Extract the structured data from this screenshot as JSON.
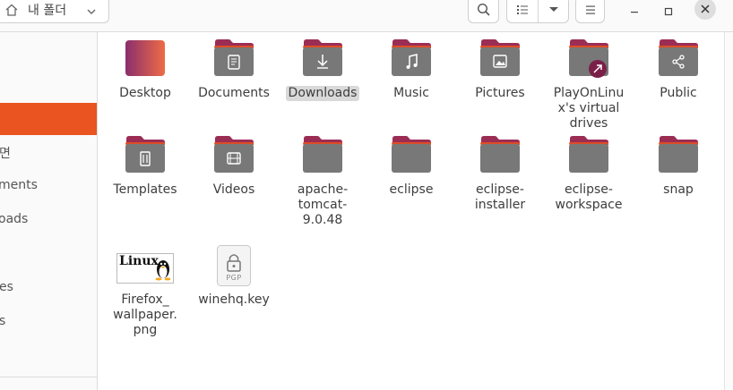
{
  "header": {
    "path_label": "내 폴더",
    "icons": [
      "home-icon",
      "chevron-down-icon",
      "search-icon",
      "list-view-icon",
      "menu-icon",
      "minimize-icon",
      "maximize-icon",
      "close-icon"
    ]
  },
  "sidebar": {
    "items": [
      {
        "label": "면"
      },
      {
        "label": "ments"
      },
      {
        "label": "oads"
      },
      {
        "label": "es"
      },
      {
        "label": "s"
      }
    ]
  },
  "colors": {
    "accent": "#e95420",
    "folder_tab": "#9b2d55",
    "folder_body": "#787878",
    "folder_top_accent": "#e95420"
  },
  "files": [
    {
      "label": "Desktop",
      "icon": "desktop-folder-icon"
    },
    {
      "label": "Documents",
      "icon": "documents-folder-icon"
    },
    {
      "label": "Downloads",
      "icon": "downloads-folder-icon",
      "selected": true
    },
    {
      "label": "Music",
      "icon": "music-folder-icon"
    },
    {
      "label": "Pictures",
      "icon": "pictures-folder-icon"
    },
    {
      "label": "PlayOnLinux's virtual drives",
      "lines": [
        "PlayOnLinu",
        "x's virtual",
        "drives"
      ],
      "icon": "link-folder-icon"
    },
    {
      "label": "Public",
      "icon": "share-folder-icon"
    },
    {
      "label": "Templates",
      "icon": "templates-folder-icon"
    },
    {
      "label": "Videos",
      "icon": "video-folder-icon"
    },
    {
      "label": "apache-tomcat-9.0.48",
      "lines": [
        "apache-",
        "tomcat-",
        "9.0.48"
      ],
      "icon": "folder-icon"
    },
    {
      "label": "eclipse",
      "icon": "folder-icon"
    },
    {
      "label": "eclipse-installer",
      "lines": [
        "eclipse-",
        "installer"
      ],
      "icon": "folder-icon"
    },
    {
      "label": "eclipse-workspace",
      "lines": [
        "eclipse-",
        "workspace"
      ],
      "icon": "folder-icon"
    },
    {
      "label": "snap",
      "icon": "folder-icon"
    },
    {
      "label": "Firefox_wallpaper.png",
      "lines": [
        "Firefox_",
        "wallpaper.",
        "png"
      ],
      "icon": "image-thumbnail-icon",
      "thumb_text": "Linux"
    },
    {
      "label": "winehq.key",
      "icon": "pgp-key-icon",
      "badge": "PGP"
    }
  ]
}
